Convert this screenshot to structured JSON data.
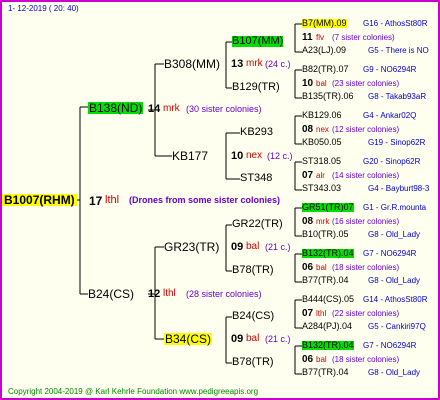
{
  "header": {
    "date": "1-  12-2019  (  20:  40)"
  },
  "footer": {
    "copyright": "Copyright 2004-2019 @ Karl Kehrle Foundation   www.pedigreeapis.org"
  },
  "root": {
    "name": "B1007(RHM)",
    "num": "17",
    "code": "lthl",
    "note": "(Drones from some sister colonies)"
  },
  "mother": {
    "name": "B138(ND)",
    "num": "14",
    "code": "mrk",
    "sisters": "(30 sister colonies)"
  },
  "father": {
    "name": "B24(CS)",
    "num": "12",
    "code": "lthl",
    "sisters": "(28 sister colonies)"
  },
  "mm": {
    "name": "B308(MM)",
    "num": "13",
    "code": "mrk",
    "sisters": "(24 c.)"
  },
  "mf": {
    "name": "KB177",
    "num": "10",
    "code": "nex",
    "sisters": "(12 c.)"
  },
  "fm": {
    "name": "GR23(TR)",
    "num": "09",
    "code": "bal",
    "sisters": "(21 c.)"
  },
  "ff": {
    "name": "B34(CS)",
    "num": "09",
    "code": "bal",
    "sisters": "(21 c.)"
  },
  "g4": [
    {
      "name": "B107(MM)"
    },
    {
      "name": "B129(TR)"
    },
    {
      "name": "KB293"
    },
    {
      "name": "ST348"
    },
    {
      "name": "GR22(TR)"
    },
    {
      "name": "B78(TR)"
    },
    {
      "name": "B24(CS)"
    },
    {
      "name": "B78(TR)"
    }
  ],
  "g5": [
    {
      "top": "B7(MM).09",
      "topr": "G16 - AthosSt80R",
      "num": "11",
      "code": "flv",
      "sis": "(7 sister colonies)",
      "bot": "A23(LJ).09",
      "botr": "G5 - There is NO"
    },
    {
      "top": "B82(TR).07",
      "topr": "G9 - NO6294R",
      "num": "10",
      "code": "bal",
      "sis": "(23 sister colonies)",
      "bot": "B135(TR).06",
      "botr": "G8 - Takab93aR"
    },
    {
      "top": "KB129.06",
      "topr": "G4 - Ankar02Q",
      "num": "08",
      "code": "nex",
      "sis": "(12 sister colonies)",
      "bot": "KB050.05",
      "botr": "G19 - Sinop62R"
    },
    {
      "top": "ST318.05",
      "topr": "G20 - Sinop62R",
      "num": "07",
      "code": "alr",
      "sis": "(14 sister colonies)",
      "bot": "ST343.03",
      "botr": "G4 - Bayburt98-3"
    },
    {
      "top": "GR51(TR)07",
      "topr": "G1 - Gr.R.mounta",
      "num": "08",
      "code": "mrk",
      "sis": "(16 sister colonies)",
      "bot": "B10(TR).05",
      "botr": "G8 - Old_Lady"
    },
    {
      "top": "B132(TR).04",
      "topr": "G7 - NO6294R",
      "num": "06",
      "code": "bal",
      "sis": "(18 sister colonies)",
      "bot": "B77(TR).04",
      "botr": "G8 - Old_Lady"
    },
    {
      "top": "B444(CS).05",
      "topr": "G14 - AthosSt80R",
      "num": "07",
      "code": "lthl",
      "sis": "(22 sister colonies)",
      "bot": "A284(PJ).04",
      "botr": "G5 - Cankiri97Q"
    },
    {
      "top": "B132(TR).04",
      "topr": "G7 - NO6294R",
      "num": "06",
      "code": "bal",
      "sis": "(18 sister colonies)",
      "bot": "B77(TR).04",
      "botr": "G8 - Old_Lady"
    }
  ],
  "colors": {
    "border": "#cc00cc",
    "highlight_green": "#00e000",
    "highlight_yellow": "#ffff00",
    "code_red": "#cc0000",
    "sister_purple": "#6600cc",
    "gen_blue": "#0000cc"
  }
}
